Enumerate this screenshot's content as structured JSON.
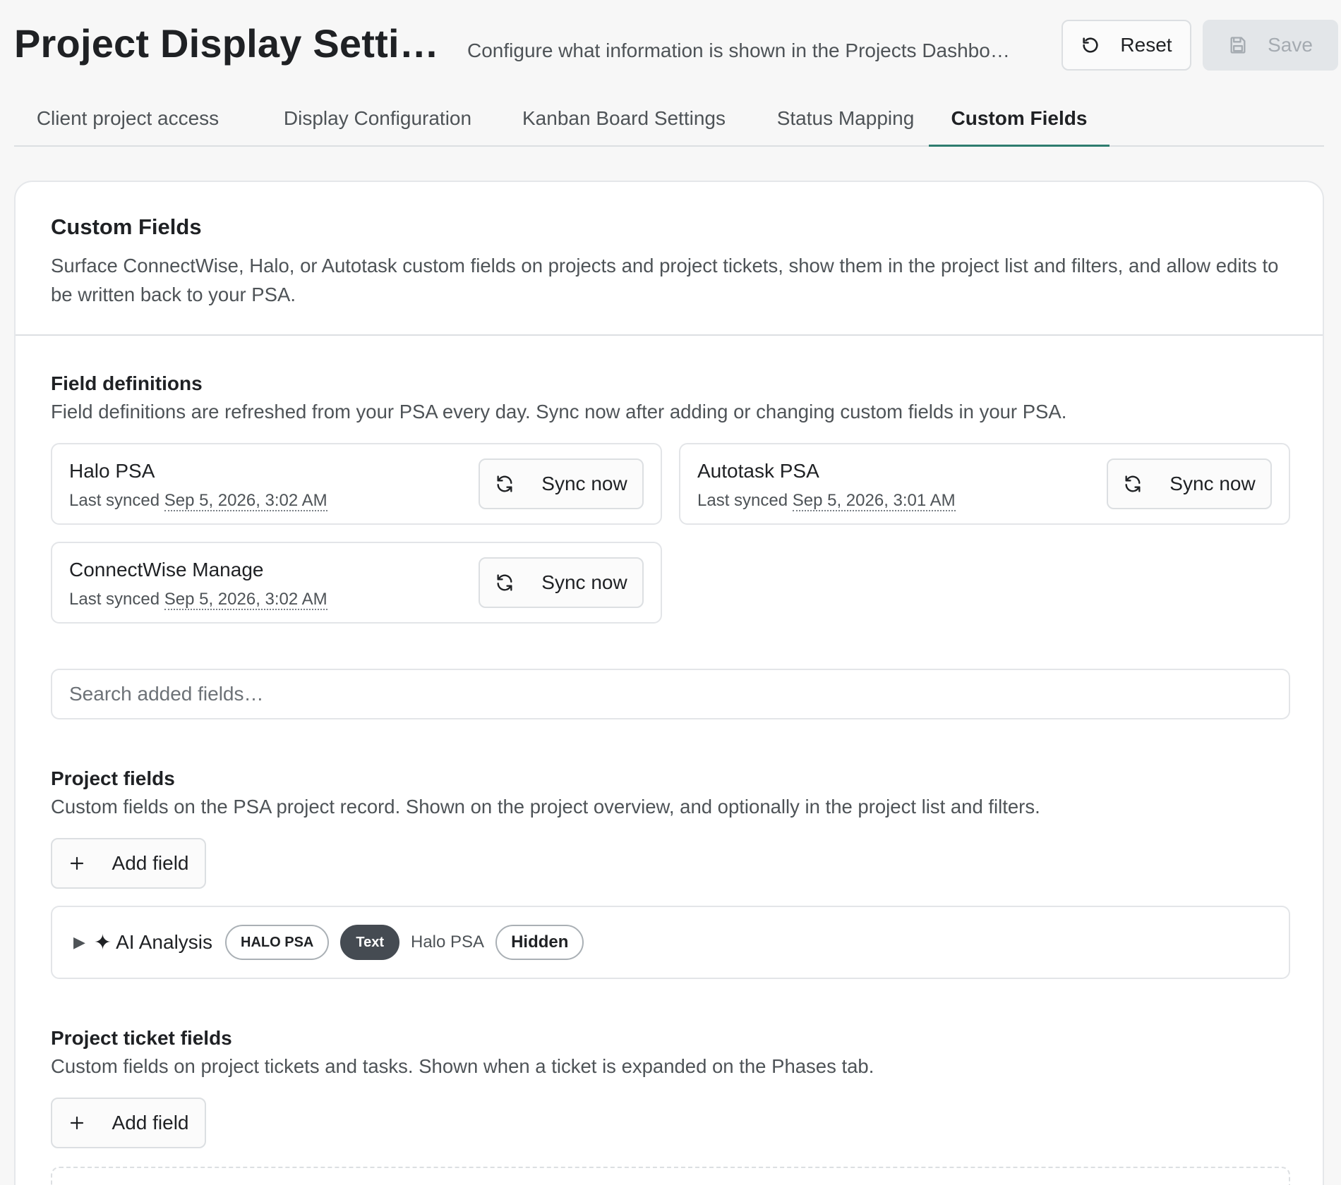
{
  "header": {
    "title": "Project Display Setti…",
    "subtitle": "Configure what information is shown in the Projects Dashbo…",
    "reset_label": "Reset",
    "save_label": "Save"
  },
  "tabs": [
    {
      "label": "Client project access"
    },
    {
      "label": "Display Configuration"
    },
    {
      "label": "Kanban Board Settings"
    },
    {
      "label": "Status Mapping"
    },
    {
      "label": "Custom Fields",
      "active": true
    }
  ],
  "card": {
    "title": "Custom Fields",
    "description": "Surface ConnectWise, Halo, or Autotask custom fields on projects and project tickets, show them in the project list and filters, and allow edits to be written back to your PSA."
  },
  "field_definitions": {
    "title": "Field definitions",
    "description": "Field definitions are refreshed from your PSA every day. Sync now after adding or changing custom fields in your PSA.",
    "last_synced_prefix": "Last synced",
    "sync_label": "Sync now",
    "sources": [
      {
        "name": "Halo PSA",
        "last_synced": "Sep 5, 2026, 3:02 AM"
      },
      {
        "name": "Autotask PSA",
        "last_synced": "Sep 5, 2026, 3:01 AM"
      },
      {
        "name": "ConnectWise Manage",
        "last_synced": "Sep 5, 2026, 3:02 AM"
      }
    ]
  },
  "search": {
    "placeholder": "Search added fields…",
    "value": ""
  },
  "project_fields": {
    "title": "Project fields",
    "description": "Custom fields on the PSA project record. Shown on the project overview, and optionally in the project list and filters.",
    "add_label": "Add field",
    "items": [
      {
        "icon": "sparkle-icon",
        "glyph": "✦",
        "name": "AI Analysis",
        "source_badge": "HALO PSA",
        "type_badge": "Text",
        "source": "Halo PSA",
        "visibility": "Hidden"
      }
    ]
  },
  "ticket_fields": {
    "title": "Project ticket fields",
    "description": "Custom fields on project tickets and tasks. Shown when a ticket is expanded on the Phases tab.",
    "add_label": "Add field"
  },
  "colors": {
    "accent": "#2e7d6f",
    "background": "#f7f7f7",
    "type_badge_bg": "#454b52",
    "save_disabled_bg": "#e3e6e9"
  }
}
